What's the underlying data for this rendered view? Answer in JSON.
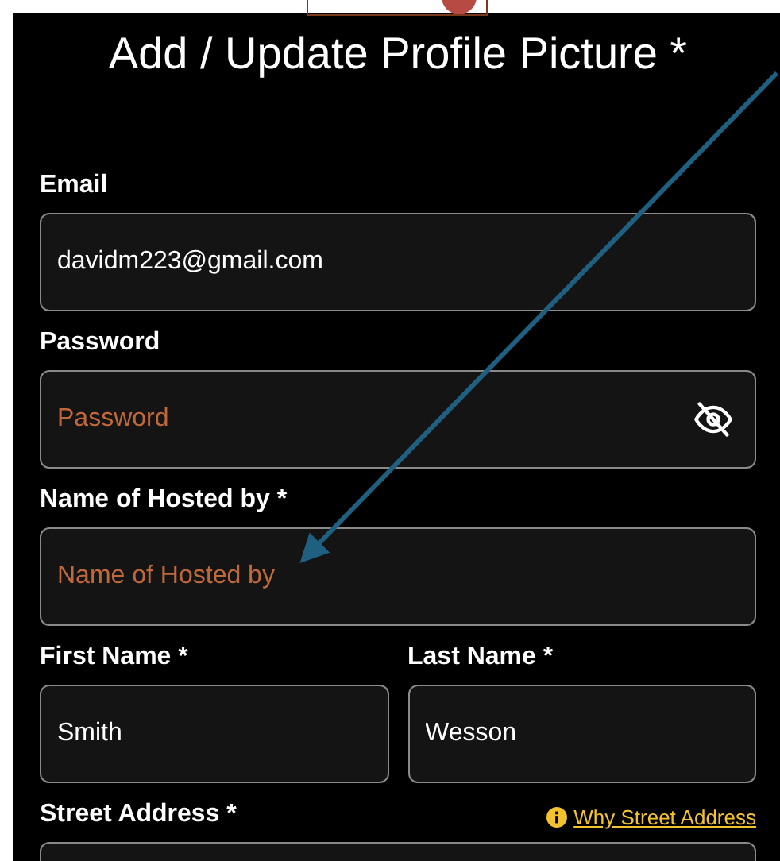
{
  "title": "Add / Update Profile Picture *",
  "fields": [
    {
      "label": "Email",
      "value": "davidm223@gmail.com",
      "kind": "text"
    },
    {
      "label": "Password",
      "placeholder": "Password",
      "kind": "password"
    },
    {
      "label": "Name of Hosted by *",
      "placeholder": "Name of Hosted by",
      "kind": "text"
    }
  ],
  "name_row": [
    {
      "label": "First Name *",
      "value": "Smith"
    },
    {
      "label": "Last Name *",
      "value": "Wesson"
    }
  ],
  "street_address": {
    "label": "Street Address *",
    "help_link": "Why Street Address"
  }
}
